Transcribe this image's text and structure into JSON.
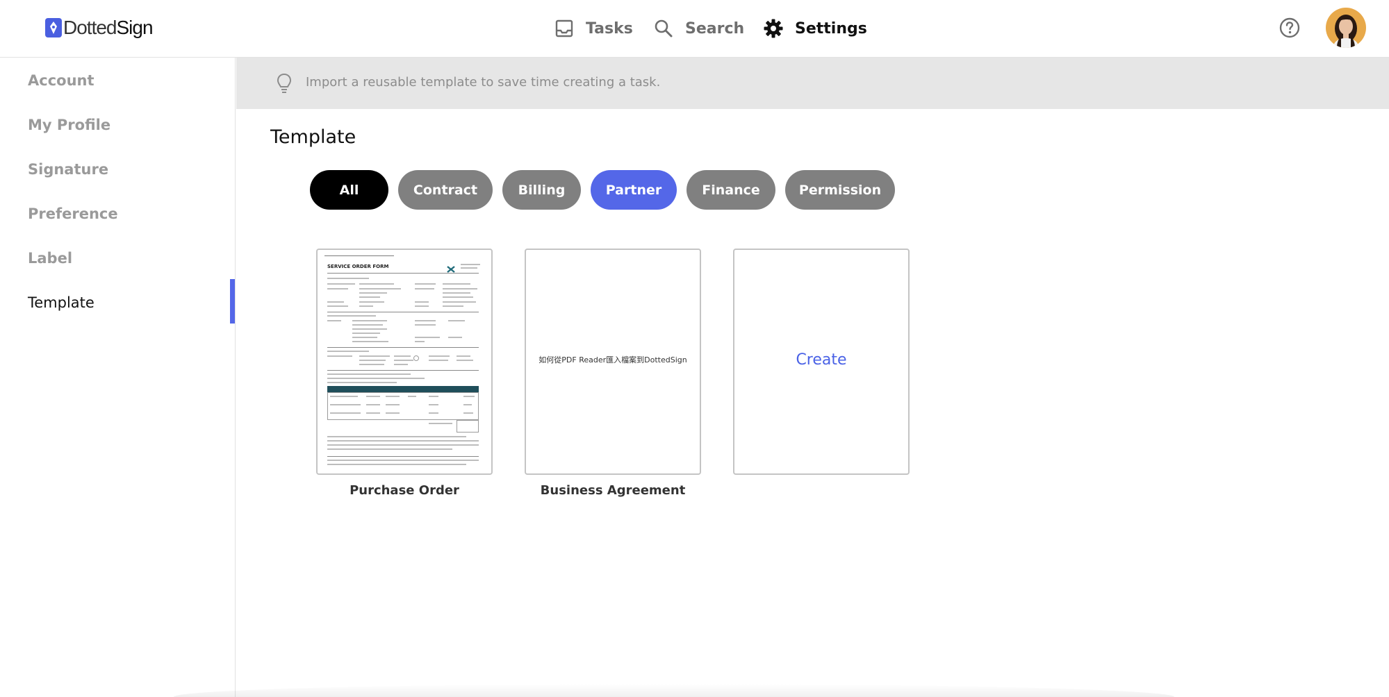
{
  "brand": {
    "name_part1": "Dotted",
    "name_part2": "Sign",
    "accent_color": "#5467e8"
  },
  "header": {
    "nav": [
      {
        "label": "Tasks",
        "icon": "inbox-tray-icon",
        "active": false
      },
      {
        "label": "Search",
        "icon": "magnifier-icon",
        "active": false
      },
      {
        "label": "Settings",
        "icon": "gear-icon",
        "active": true
      }
    ],
    "help_icon": "question-circle-icon",
    "avatar_icon": "user-avatar"
  },
  "sidebar": {
    "items": [
      {
        "label": "Account",
        "active": false
      },
      {
        "label": "My Profile",
        "active": false
      },
      {
        "label": "Signature",
        "active": false
      },
      {
        "label": "Preference",
        "active": false
      },
      {
        "label": "Label",
        "active": false
      },
      {
        "label": "Template",
        "active": true
      }
    ]
  },
  "tip": {
    "icon": "lightbulb-icon",
    "text": "Import a reusable template to save time creating a task."
  },
  "main": {
    "title": "Template",
    "filters": [
      {
        "label": "All",
        "state": "selected",
        "color": "#000000"
      },
      {
        "label": "Contract",
        "state": "default",
        "color": "#808080"
      },
      {
        "label": "Billing",
        "state": "default",
        "color": "#808080"
      },
      {
        "label": "Partner",
        "state": "selected",
        "color": "#5467e8"
      },
      {
        "label": "Finance",
        "state": "default",
        "color": "#808080"
      },
      {
        "label": "Permission",
        "state": "default",
        "color": "#808080"
      }
    ],
    "templates": [
      {
        "caption": "Purchase Order",
        "preview_heading": "SERVICE ORDER FORM"
      },
      {
        "caption": "Business Agreement",
        "preview_text": "如何從PDF Reader匯入檔案到DottedSign"
      },
      {
        "action_label": "Create"
      }
    ]
  }
}
